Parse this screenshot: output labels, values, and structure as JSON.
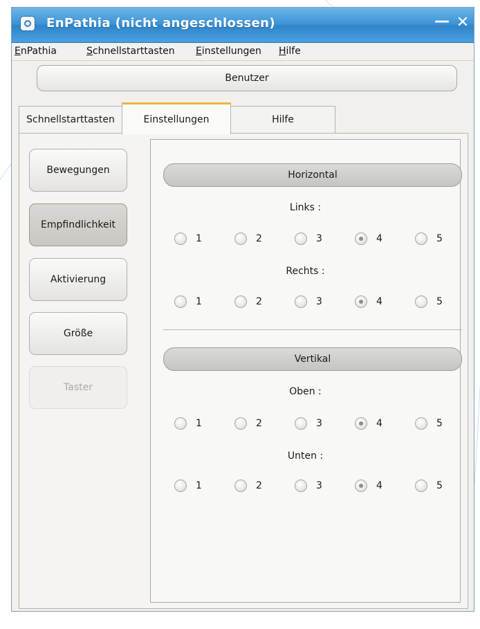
{
  "window": {
    "title": "EnPathia (nicht angeschlossen)",
    "minimize_glyph": "—",
    "close_glyph": "✕"
  },
  "menu": [
    {
      "first": "E",
      "rest": "nPathia"
    },
    {
      "first": "S",
      "rest": "chnellstarttasten"
    },
    {
      "first": "E",
      "rest": "instellungen"
    },
    {
      "first": "H",
      "rest": "ilfe"
    }
  ],
  "benutzer_label": "Benutzer",
  "tabs": [
    {
      "label": "Schnellstarttasten",
      "active": false
    },
    {
      "label": "Einstellungen",
      "active": true
    },
    {
      "label": "Hilfe",
      "active": false
    }
  ],
  "sidebar": [
    {
      "label": "Bewegungen",
      "state": "normal"
    },
    {
      "label": "Empfindlichkeit",
      "state": "selected"
    },
    {
      "label": "Aktivierung",
      "state": "normal"
    },
    {
      "label": "Größe",
      "state": "normal"
    },
    {
      "label": "Taster",
      "state": "disabled"
    }
  ],
  "sections": [
    {
      "title": "Horizontal",
      "groups": [
        {
          "label": "Links :",
          "options": [
            "1",
            "2",
            "3",
            "4",
            "5"
          ],
          "selected": "4"
        },
        {
          "label": "Rechts :",
          "options": [
            "1",
            "2",
            "3",
            "4",
            "5"
          ],
          "selected": "4"
        }
      ]
    },
    {
      "title": "Vertikal",
      "groups": [
        {
          "label": "Oben :",
          "options": [
            "1",
            "2",
            "3",
            "4",
            "5"
          ],
          "selected": "4"
        },
        {
          "label": "Unten :",
          "options": [
            "1",
            "2",
            "3",
            "4",
            "5"
          ],
          "selected": "4"
        }
      ]
    }
  ],
  "colors": {
    "titlebar": "#3d93d6",
    "active_tab_accent": "#f2b33d",
    "window_bg": "#f1f0ec"
  }
}
